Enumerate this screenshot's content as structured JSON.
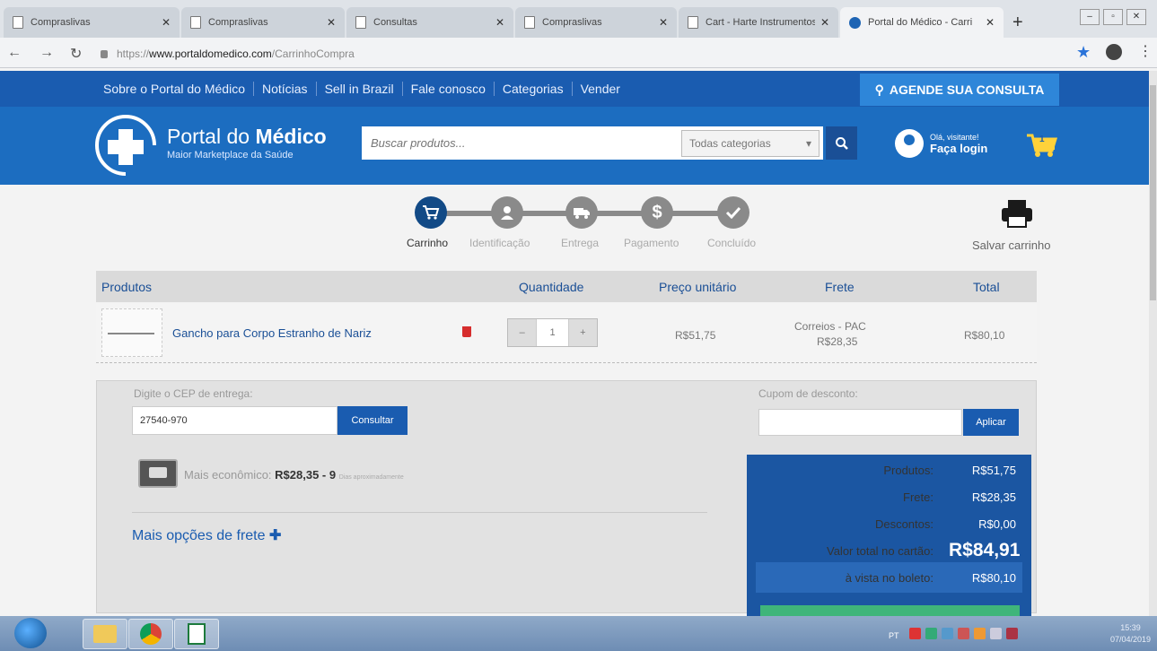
{
  "browser": {
    "tabs": [
      {
        "title": "Compraslivas"
      },
      {
        "title": "Compraslivas"
      },
      {
        "title": "Consultas"
      },
      {
        "title": "Compraslivas"
      },
      {
        "title": "Cart - Harte Instrumentos"
      },
      {
        "title": "Portal do Médico - Carri"
      }
    ],
    "url_host": "www.portaldomedico.com",
    "url_path": "/CarrinhoCompra",
    "url_scheme": "https://"
  },
  "topnav": {
    "links": [
      "Sobre o Portal do Médico",
      "Notícias",
      "Sell in Brazil",
      "Fale conosco",
      "Categorias",
      "Vender"
    ],
    "agende": "AGENDE SUA CONSULTA"
  },
  "header": {
    "logo_title_pre": "Portal do",
    "logo_title_bold": "Médico",
    "logo_sub": "Maior Marketplace da Saúde",
    "search_placeholder": "Buscar produtos...",
    "category": "Todas categorias",
    "greeting": "Olá, visitante!",
    "login": "Faça login",
    "cart_count": "1"
  },
  "steps": [
    {
      "label": "Carrinho",
      "icon": "cart-icon",
      "active": true
    },
    {
      "label": "Identificação",
      "icon": "user-icon",
      "active": false
    },
    {
      "label": "Entrega",
      "icon": "truck-icon",
      "active": false
    },
    {
      "label": "Pagamento",
      "icon": "dollar-icon",
      "active": false
    },
    {
      "label": "Concluído",
      "icon": "check-icon",
      "active": false
    }
  ],
  "save_cart": "Salvar carrinho",
  "table": {
    "headers": {
      "produtos": "Produtos",
      "quantidade": "Quantidade",
      "preco": "Preço unitário",
      "frete": "Frete",
      "total": "Total"
    },
    "item": {
      "name": "Gancho para Corpo Estranho de Nariz",
      "qty": "1",
      "price": "R$51,75",
      "shipping_method": "Correios - PAC",
      "shipping_price": "R$28,35",
      "total": "R$80,10"
    }
  },
  "shipping": {
    "cep_label": "Digite o CEP de entrega:",
    "cep_value": "27540-970",
    "consultar": "Consultar",
    "cheapest_label": "Mais econômico:",
    "cheapest_value": "R$28,35 - 9",
    "cheapest_days": "Dias aproximadamente",
    "more_options": "Mais opções de frete"
  },
  "coupon": {
    "label": "Cupom de desconto:",
    "apply": "Aplicar"
  },
  "summary": {
    "produtos_label": "Produtos:",
    "produtos_value": "R$51,75",
    "frete_label": "Frete:",
    "frete_value": "R$28,35",
    "descontos_label": "Descontos:",
    "descontos_value": "R$0,00",
    "cartao_label": "Valor total no cartão:",
    "cartao_value": "R$84,91",
    "boleto_label": "à vista no boleto:",
    "boleto_value": "R$80,10"
  },
  "taskbar": {
    "lang": "PT",
    "time": "15:39",
    "date": "07/04/2019"
  },
  "colors": {
    "brand_dark": "#1a5cb0",
    "brand_header": "#1c6dc0",
    "agende": "#2e86d9",
    "step_active": "#124a86"
  }
}
